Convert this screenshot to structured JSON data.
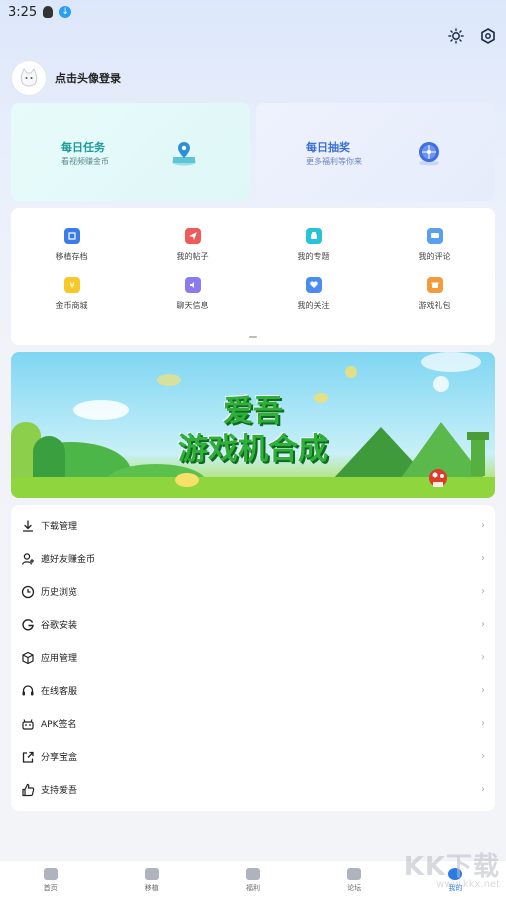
{
  "status_bar": {
    "time": "3:25"
  },
  "profile": {
    "login_text": "点击头像登录"
  },
  "daily_task": {
    "title": "每日任务",
    "subtitle": "看视频赚金币"
  },
  "daily_lottery": {
    "title": "每日抽奖",
    "subtitle": "更多福利等你来"
  },
  "grid": {
    "items": [
      {
        "label": "移植存档",
        "color": "#3b7ce8"
      },
      {
        "label": "我的帖子",
        "color": "#f05a5a"
      },
      {
        "label": "我的专题",
        "color": "#27c4d8"
      },
      {
        "label": "我的评论",
        "color": "#5aa0f0"
      },
      {
        "label": "金币商城",
        "color": "#f5c92a"
      },
      {
        "label": "聊天信息",
        "color": "#8a7cf0"
      },
      {
        "label": "我的关注",
        "color": "#4b8cf0"
      },
      {
        "label": "游戏礼包",
        "color": "#f59a3a"
      }
    ]
  },
  "banner": {
    "line1": "爱吾",
    "line2": "游戏机合成"
  },
  "menu": {
    "items": [
      {
        "label": "下载管理",
        "icon": "download-icon"
      },
      {
        "label": "邀好友赚金币",
        "icon": "user-add-icon"
      },
      {
        "label": "历史浏览",
        "icon": "clock-icon"
      },
      {
        "label": "谷歌安装",
        "icon": "google-icon"
      },
      {
        "label": "应用管理",
        "icon": "cube-icon"
      },
      {
        "label": "在线客服",
        "icon": "headset-icon"
      },
      {
        "label": "APK签名",
        "icon": "android-icon"
      },
      {
        "label": "分享宝盒",
        "icon": "share-icon"
      },
      {
        "label": "支持爱吾",
        "icon": "thumbs-up-icon"
      }
    ]
  },
  "tabbar": {
    "tabs": [
      {
        "label": "首页"
      },
      {
        "label": "移植"
      },
      {
        "label": "福利"
      },
      {
        "label": "论坛"
      },
      {
        "label": "我的"
      }
    ]
  },
  "watermark": {
    "line1": "KK下载",
    "line2": "www.kkx.net"
  }
}
